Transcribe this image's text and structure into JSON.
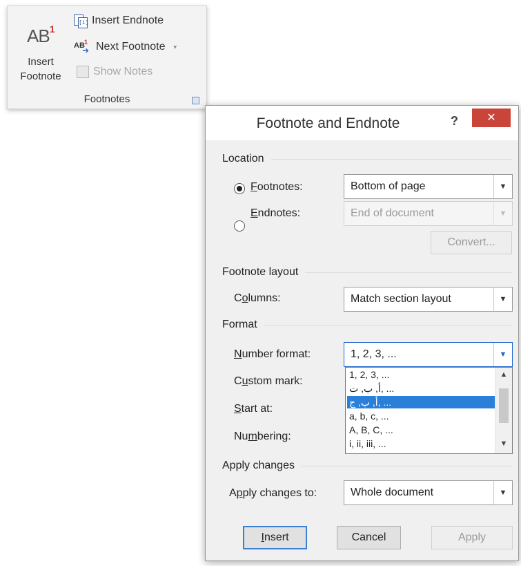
{
  "ribbon": {
    "group_label": "Footnotes",
    "insert_footnote": {
      "glyph": "AB",
      "superscript": "1",
      "label_line1": "Insert",
      "label_line2": "Footnote"
    },
    "insert_endnote": {
      "label": "Insert Endnote",
      "icon_glyph": "[i]"
    },
    "next_footnote": {
      "label": "Next Footnote",
      "icon_glyph": "AB",
      "icon_sup": "1",
      "arrow": "▾"
    },
    "show_notes": {
      "label": "Show Notes"
    }
  },
  "dialog": {
    "title": "Footnote and Endnote",
    "help_label": "?",
    "close_label": "✕",
    "location": {
      "heading": "Location",
      "footnotes": {
        "label_underlined": "F",
        "label_rest": "ootnotes:",
        "value": "Bottom of page",
        "checked": true
      },
      "endnotes": {
        "label_underlined": "E",
        "label_rest": "ndnotes:",
        "value": "End of document",
        "checked": false
      },
      "convert_label": "Convert..."
    },
    "footnote_layout": {
      "heading": "Footnote layout",
      "columns": {
        "label_pre": "C",
        "label_underlined": "o",
        "label_rest": "lumns:",
        "value": "Match section layout"
      }
    },
    "format": {
      "heading": "Format",
      "number_format": {
        "label_underlined": "N",
        "label_rest": "umber format:",
        "value": "1, 2, 3, ..."
      },
      "custom_mark": {
        "label_pre": "C",
        "label_underlined": "u",
        "label_rest": "stom mark:"
      },
      "start_at": {
        "label_underlined": "S",
        "label_rest": "tart at:"
      },
      "numbering": {
        "label_pre": "Nu",
        "label_underlined": "m",
        "label_rest": "bering:"
      },
      "dropdown_options": [
        "1, 2, 3, ...",
        "أ, ب, ت, ...",
        "أ, ب, ج, ...",
        "a, b, c, ...",
        "A, B, C, ...",
        "i, ii, iii, ..."
      ],
      "selected_option": "أ, ب, ج, ..."
    },
    "apply_changes": {
      "heading": "Apply changes",
      "apply_to": {
        "label_pre": "A",
        "label_underlined": "p",
        "label_rest": "ply changes to:",
        "value": "Whole document"
      }
    },
    "buttons": {
      "insert": {
        "label_underlined": "I",
        "label_rest": "nsert"
      },
      "cancel": "Cancel",
      "apply": "Apply"
    }
  },
  "colors": {
    "close_button": "#c9453a",
    "selection": "#2a7fd8",
    "footnote_superscript": "#d22b2b"
  }
}
